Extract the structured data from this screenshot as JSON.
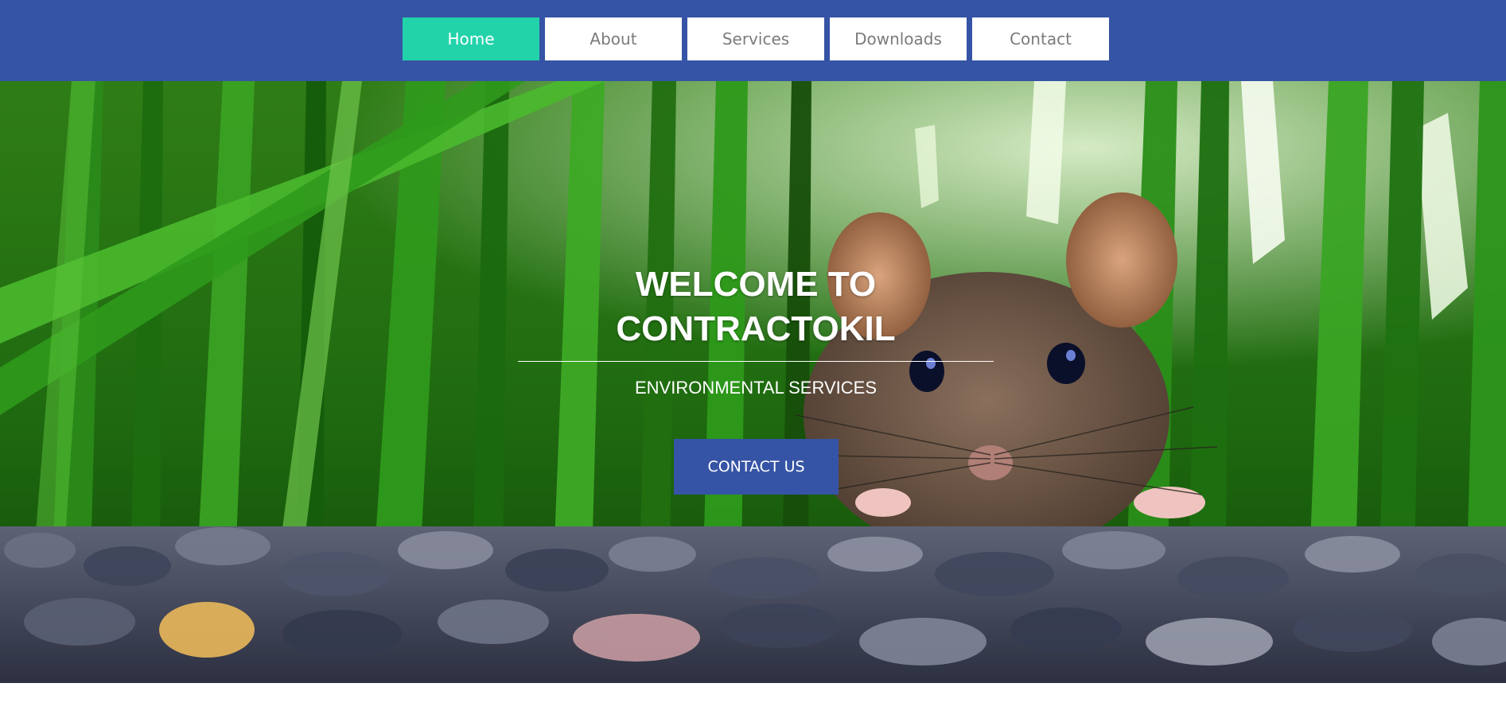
{
  "nav": {
    "items": [
      {
        "label": "Home",
        "active": true
      },
      {
        "label": "About",
        "active": false
      },
      {
        "label": "Services",
        "active": false
      },
      {
        "label": "Downloads",
        "active": false
      },
      {
        "label": "Contact",
        "active": false
      }
    ]
  },
  "hero": {
    "title_line1": "WELCOME TO",
    "title_line2": "CONTRACTOKIL",
    "subtitle": "ENVIRONMENTAL SERVICES",
    "cta_label": "CONTACT US",
    "image_alt": "mouse-peeking-from-grass-photo"
  },
  "colors": {
    "header_bg": "#3654a5",
    "nav_active": "#22d3aa",
    "nav_text": "#7b7b7b",
    "cta_bg": "#3654a5"
  }
}
